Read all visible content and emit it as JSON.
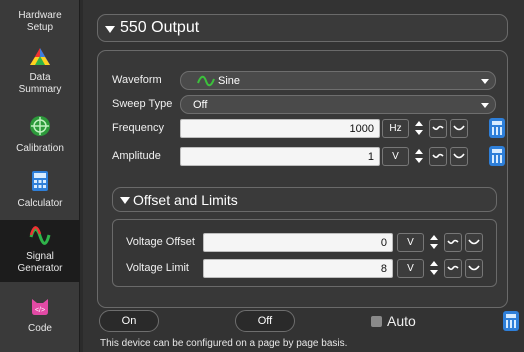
{
  "sidebar": {
    "items": [
      {
        "label": "Hardware Setup",
        "icon": "hardware-icon"
      },
      {
        "label": "Data Summary",
        "icon": "data-summary-icon"
      },
      {
        "label": "Calibration",
        "icon": "calibration-icon"
      },
      {
        "label": "Calculator",
        "icon": "calculator-icon"
      },
      {
        "label": "Signal Generator",
        "icon": "signal-generator-icon",
        "active": true
      },
      {
        "label": "Code",
        "icon": "code-icon"
      }
    ]
  },
  "output": {
    "title": "550 Output",
    "waveform_label": "Waveform",
    "waveform_value": "Sine",
    "sweep_label": "Sweep Type",
    "sweep_value": "Off",
    "frequency_label": "Frequency",
    "frequency_value": "1000",
    "frequency_unit": "Hz",
    "amplitude_label": "Amplitude",
    "amplitude_value": "1",
    "amplitude_unit": "V"
  },
  "offset_limits": {
    "title": "Offset and Limits",
    "offset_label": "Voltage Offset",
    "offset_value": "0",
    "offset_unit": "V",
    "limit_label": "Voltage Limit",
    "limit_value": "8",
    "limit_unit": "V"
  },
  "controls": {
    "on_label": "On",
    "off_label": "Off",
    "auto_label": "Auto",
    "auto_checked": false
  },
  "footer": {
    "message": "This device can be configured on a page by page basis."
  },
  "colors": {
    "sine_icon": "#3cc13c",
    "calc_icon": "#2e7fd9"
  }
}
